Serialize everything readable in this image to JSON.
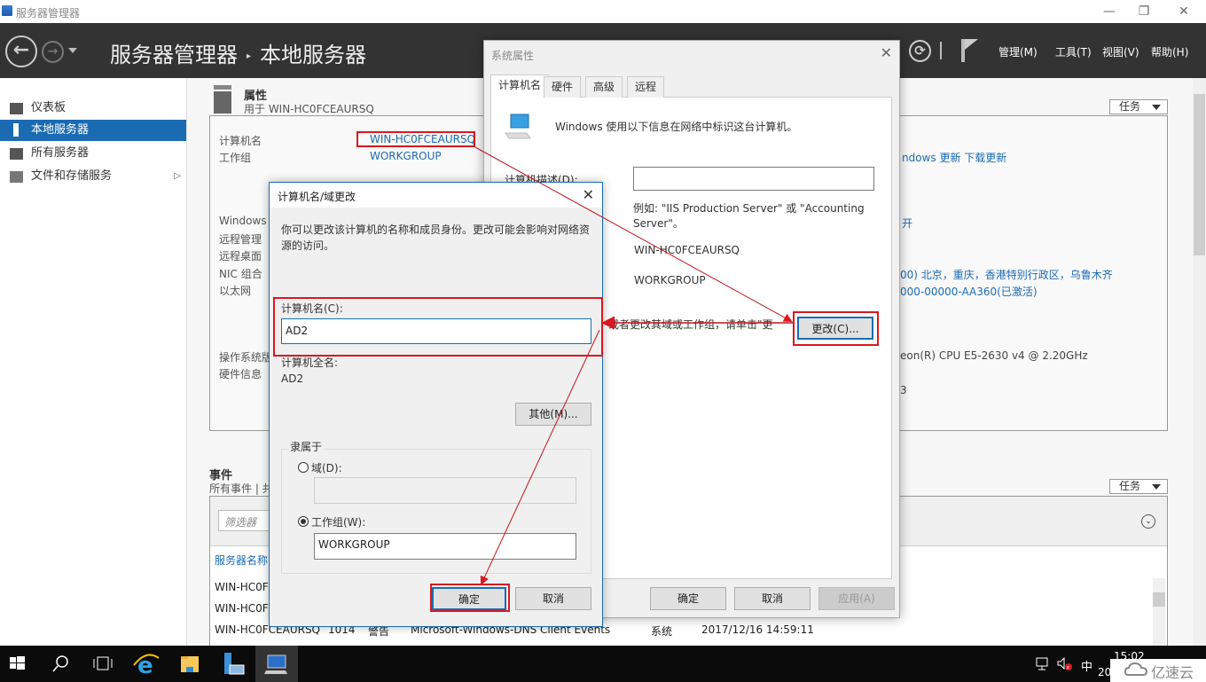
{
  "window": {
    "title": "服务器管理器",
    "minimize": "—",
    "restore": "❐",
    "close": "✕"
  },
  "header": {
    "breadcrumb": [
      "服务器管理器",
      "本地服务器"
    ],
    "breadcrumb_sep": "▸",
    "back_glyph": "←",
    "forward_glyph": "→",
    "refresh_glyph": "⟳",
    "menus": [
      "管理(M)",
      "工具(T)",
      "视图(V)",
      "帮助(H)"
    ]
  },
  "sidebar": {
    "items": [
      {
        "label": "仪表板",
        "icon": "dashboard-icon"
      },
      {
        "label": "本地服务器",
        "icon": "server-icon",
        "active": true
      },
      {
        "label": "所有服务器",
        "icon": "servers-icon"
      },
      {
        "label": "文件和存储服务",
        "icon": "storage-icon",
        "has_submenu": true,
        "arrow": "▷"
      }
    ]
  },
  "properties": {
    "title": "属性",
    "subtitle": "用于 WIN-HC0FCEAURSQ",
    "tasks_label": "任务",
    "labels": [
      "计算机名",
      "工作组",
      "Windows",
      "远程管理",
      "远程桌面",
      "NIC 组合",
      "以太网",
      "操作系统版",
      "硬件信息"
    ],
    "computer_name": "WIN-HC0FCEAURSQ",
    "workgroup": "WORKGROUP",
    "windows_update": "ndows 更新 下载更新",
    "remote_open": "开",
    "timezone": "00) 北京，重庆，香港特别行政区，乌鲁木齐",
    "product_id": "000-00000-AA360(已激活)",
    "cpu": "eon(R) CPU E5-2630 v4 @ 2.20GHz",
    "memory_tail": "3"
  },
  "events": {
    "title": "事件",
    "subtitle": "所有事件 | 共",
    "tasks_label": "任务",
    "filter_placeholder": "筛选器",
    "column_server": "服务器名称",
    "expand_glyph": "⌄",
    "rows": [
      {
        "server": "WIN-HC0F"
      },
      {
        "server": "WIN-HC0F"
      },
      {
        "server": "WIN-HC0FCEAURSQ",
        "id": "1014",
        "severity": "警告",
        "source": "Microsoft-Windows-DNS Client Events",
        "log": "系统",
        "date": "2017/12/16 14:59:11"
      }
    ]
  },
  "sysprop": {
    "title": "系统属性",
    "close": "✕",
    "tabs": [
      "计算机名",
      "硬件",
      "高级",
      "远程"
    ],
    "intro": "Windows 使用以下信息在网络中标识这台计算机。",
    "desc_label": "计算机描述(D):",
    "desc_value": "",
    "example": "例如: \"IIS Production Server\" 或 \"Accounting Server\"。",
    "full_name": "WIN-HC0FCEAURSQ",
    "workgroup": "WORKGROUP",
    "change_hint": "或者更改其域或工作组，请单击\"更",
    "change_btn": "更改(C)...",
    "ok": "确定",
    "cancel": "取消",
    "apply": "应用(A)"
  },
  "change_dialog": {
    "title": "计算机名/域更改",
    "close": "✕",
    "intro": "你可以更改该计算机的名称和成员身份。更改可能会影响对网络资源的访问。",
    "name_label": "计算机名(C):",
    "name_value": "AD2",
    "full_name_label": "计算机全名:",
    "full_name_value": "AD2",
    "more_btn": "其他(M)...",
    "member_of": "隶属于",
    "domain_label": "域(D):",
    "domain_value": "",
    "domain_checked": false,
    "workgroup_label": "工作组(W):",
    "workgroup_value": "WORKGROUP",
    "workgroup_checked": true,
    "ok": "确定",
    "cancel": "取消"
  },
  "taskbar": {
    "items": [
      "start",
      "search",
      "task-view",
      "internet-explorer",
      "file-explorer",
      "server-manager",
      "system-properties"
    ],
    "clock_time": "15:02",
    "clock_date": "20",
    "ime": "中",
    "watermark": "亿速云"
  },
  "colors": {
    "accent": "#1b6bb3",
    "annotation_red": "#d9181f",
    "header_bg": "#333333"
  }
}
